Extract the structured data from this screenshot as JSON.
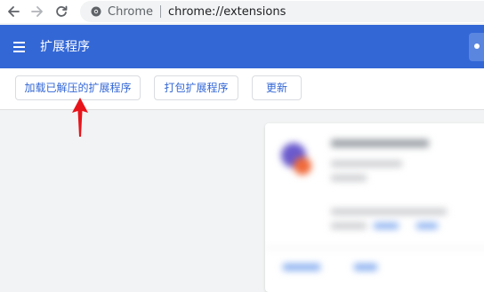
{
  "browser": {
    "omnibox": {
      "site_name": "Chrome",
      "url": "chrome://extensions"
    }
  },
  "header": {
    "title": "扩展程序"
  },
  "actions": {
    "load_unpacked": "加载已解压的扩展程序",
    "pack_extension": "打包扩展程序",
    "update": "更新"
  },
  "colors": {
    "header_blue": "#3367d6",
    "button_text": "#3367d6",
    "arrow_red": "#e8141b"
  },
  "icons": {
    "back": "arrow-left-icon",
    "forward": "arrow-right-icon",
    "reload": "reload-icon",
    "site": "chrome-info-icon",
    "menu": "hamburger-menu-icon",
    "annotation": "red-up-arrow-icon"
  }
}
